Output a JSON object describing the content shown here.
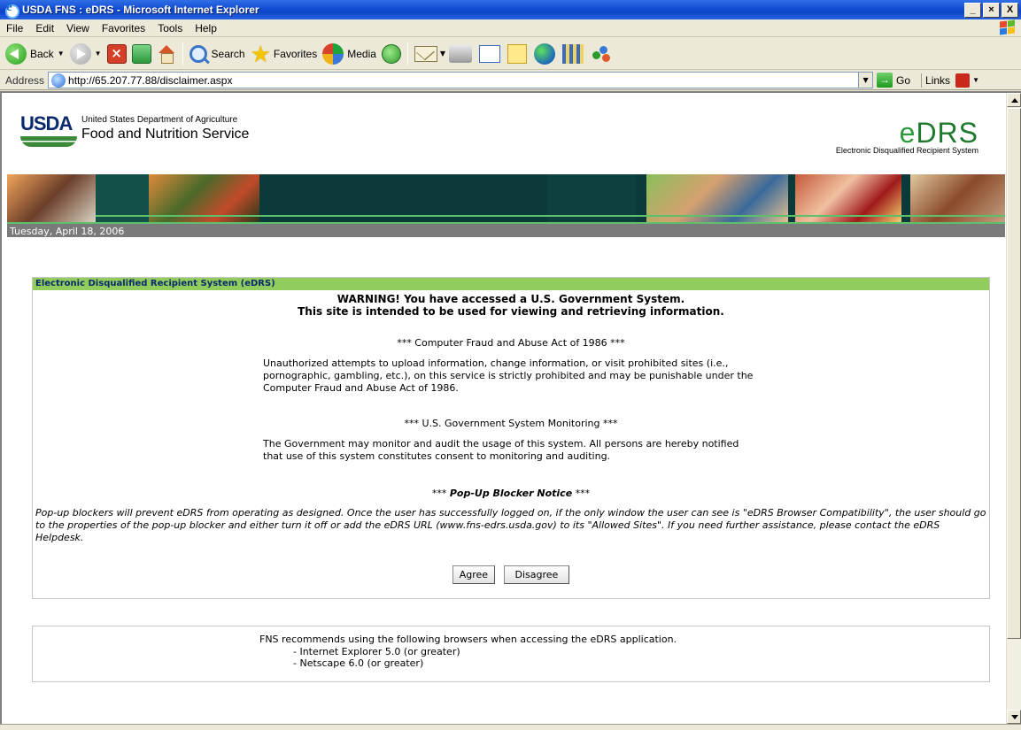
{
  "window": {
    "title": "USDA FNS : eDRS - Microsoft Internet Explorer",
    "minimize": "_",
    "maximize": "×",
    "close": "X"
  },
  "menu": [
    "File",
    "Edit",
    "View",
    "Favorites",
    "Tools",
    "Help"
  ],
  "toolbar": {
    "back": "Back",
    "search": "Search",
    "favorites": "Favorites",
    "media": "Media"
  },
  "address": {
    "label": "Address",
    "url": "http://65.207.77.88/disclaimer.aspx",
    "go": "Go",
    "links": "Links"
  },
  "header": {
    "usda": "USDA",
    "department": "United States Department of Agriculture",
    "agency": "Food and Nutrition Service",
    "edrs_e": "e",
    "edrs_rest": "DRS",
    "edrs_full": "Electronic Disqualified Recipient System"
  },
  "date": "Tuesday, April 18, 2006",
  "disclaimer": {
    "panel_title": "Electronic Disqualified Recipient System (eDRS)",
    "warning_line1": "WARNING! You have accessed a U.S. Government System.",
    "warning_line2": "This site is intended to be used for viewing and retrieving information.",
    "fraud_head": "*** Computer Fraud and Abuse Act of 1986 ***",
    "fraud_body": "Unauthorized attempts to upload information, change information, or visit prohibited sites (i.e., pornographic, gambling, etc.), on this service is strictly prohibited and may be punishable under the Computer Fraud and Abuse Act of 1986.",
    "monitor_head": "*** U.S. Government System Monitoring ***",
    "monitor_body": "The Government may monitor and audit the usage of this system. All persons are hereby notified that use of this system constitutes consent to monitoring and auditing.",
    "popup_stars_left": "***",
    "popup_head": "Pop-Up Blocker Notice",
    "popup_stars_right": "***",
    "popup_body": "Pop-up blockers will prevent eDRS from operating as designed. Once the user has successfully logged on, if the only window the user can see is \"eDRS Browser Compatibility\", the user should go to the properties of the pop-up blocker and either turn it off or add the eDRS URL (www.fns-edrs.usda.gov) to its \"Allowed Sites\". If you need further assistance, please contact the eDRS Helpdesk.",
    "agree": "Agree",
    "disagree": "Disagree"
  },
  "browsers": {
    "intro": "FNS recommends using the following browsers when accessing the eDRS application.",
    "items": [
      "- Internet Explorer 5.0 (or greater)",
      "- Netscape 6.0 (or greater)"
    ]
  },
  "colors": {
    "panel_header": "#92cc5c",
    "banner": "#0b3a3a",
    "datebar": "#7a7a7a",
    "accent_green": "#5ec06a"
  }
}
